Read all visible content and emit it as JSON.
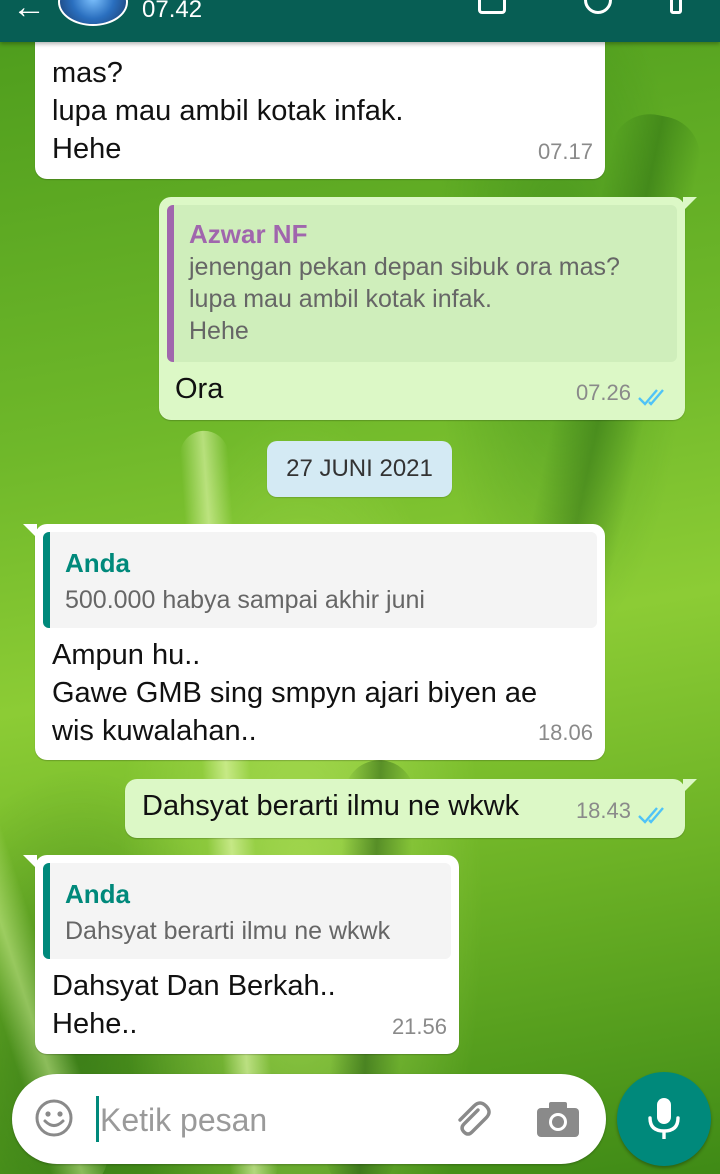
{
  "header": {
    "subtitle": "07.42"
  },
  "messages": [
    {
      "id": "m1",
      "direction": "incoming",
      "text": "mas?\nlupa mau ambil kotak infak.\nHehe",
      "time": "07.17"
    },
    {
      "id": "m2",
      "direction": "outgoing",
      "quote": {
        "author": "Azwar NF",
        "text": "jenengan pekan depan sibuk ora mas?\nlupa mau ambil kotak infak.\nHehe"
      },
      "text": "Ora",
      "time": "07.26",
      "status": "read"
    },
    {
      "id": "m3",
      "direction": "incoming",
      "quote": {
        "author": "Anda",
        "text": "500.000 habya sampai akhir juni"
      },
      "text": "Ampun hu..\nGawe GMB sing smpyn ajari biyen ae\nwis kuwalahan..",
      "time": "18.06"
    },
    {
      "id": "m4",
      "direction": "outgoing",
      "text": "Dahsyat berarti ilmu ne wkwk",
      "time": "18.43",
      "status": "read"
    },
    {
      "id": "m5",
      "direction": "incoming",
      "quote": {
        "author": "Anda",
        "text": "Dahsyat berarti ilmu ne wkwk"
      },
      "text": "Dahsyat Dan Berkah..\nHehe..",
      "time": "21.56"
    }
  ],
  "date_separator": "27 JUNI 2021",
  "composer": {
    "placeholder": "Ketik pesan"
  },
  "icons": {
    "emoji": "emoji-icon",
    "attach": "paperclip-icon",
    "camera": "camera-icon",
    "mic": "microphone-icon",
    "read_ticks": "double-check-icon"
  },
  "colors": {
    "header": "#075e54",
    "incoming_bubble": "#ffffff",
    "outgoing_bubble": "#dcf8c6",
    "read_ticks": "#4fc3f7",
    "accent": "#00897b",
    "quote_author_azwar": "#a066ad",
    "quote_author_anda": "#00897b"
  }
}
